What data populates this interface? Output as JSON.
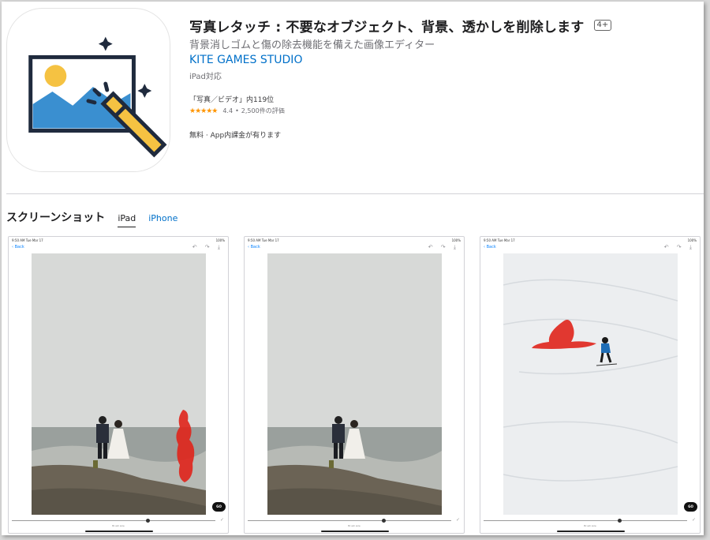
{
  "app": {
    "title": "写真レタッチ : 不要なオブジェクト、背景、透かしを削除します",
    "age_rating": "4+",
    "subtitle": "背景消しゴムと傷の除去機能を備えた画像エディター",
    "developer": "KITE GAMES STUDIO",
    "compatibility": "iPad対応",
    "rank": "「写真／ビデオ」内119位",
    "rating_stars": "★★★★★",
    "rating_value": "4.4",
    "rating_sep": "•",
    "rating_count": "2,500件の評価",
    "price": "無料 · App内課金が有ります",
    "icon_name": "photo-with-magic-wand-icon"
  },
  "screenshots": {
    "heading": "スクリーンショット",
    "tabs": [
      {
        "label": "iPad",
        "active": true
      },
      {
        "label": "iPhone",
        "active": false
      }
    ],
    "status_time": "9:50 AM   Tue Mar 17",
    "status_battery": "100%",
    "back_label": "‹ Back",
    "tools": "↶ ↷ ⤓",
    "go_label": "GO",
    "check": "✓",
    "brush_label": "Brush size",
    "items": [
      {
        "scene": "beach-couple",
        "mask": "red-person-mask",
        "slider_level": 0.66
      },
      {
        "scene": "beach-couple",
        "mask": "none",
        "slider_level": 0.66
      },
      {
        "scene": "snow-skier",
        "mask": "red-skier-mask",
        "slider_level": 0.66
      }
    ]
  },
  "colors": {
    "accent": "#0070c9",
    "mask": "#e0241b",
    "icon_blue": "#3a8fd0",
    "icon_yellow": "#f5c242",
    "icon_outline": "#1f2a3d"
  }
}
